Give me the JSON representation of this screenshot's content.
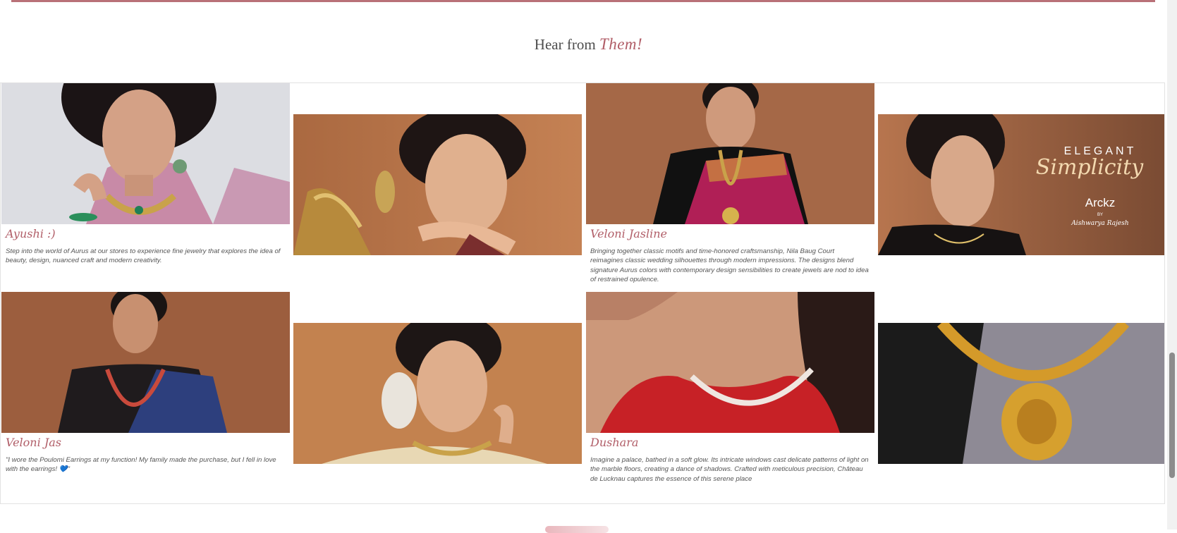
{
  "section": {
    "heading_prefix": "Hear from",
    "heading_accent": "Them!"
  },
  "testimonials": [
    {
      "name": "Ayushi :)",
      "text": "Step into the world of Aurus at our stores to experience fine jewelry that explores the idea of beauty, design, nuanced craft and modern creativity.",
      "photo": "woman in pink saree with green stone necklace and earrings"
    },
    {
      "name": "",
      "text": "",
      "photo": "woman with hand under chin wearing jhumka earrings, brass lotus"
    },
    {
      "name": "Veloni Jasline",
      "text": "Bringing together classic motifs and time-honored craftsmanship, Nila Baug Court reimagines classic wedding silhouettes through modern impressions. The designs blend signature Aurus colors with contemporary design sensibilities to create jewels are nod to idea of restrained opulence.",
      "photo": "woman in magenta saree with layered gold necklace"
    },
    {
      "name": "",
      "text": "",
      "photo": "ELEGANT Simplicity banner",
      "banner_line1": "ELEGANT",
      "banner_line2": "Simplicity",
      "banner_logo": "Arckz",
      "banner_by": "BY",
      "banner_sig": "Aishwarya Rajesh"
    },
    {
      "name": "Veloni Jas",
      "text": "\"I wore the Poulomi Earrings at my function! My family made the purchase, but I fell in love with the earrings! 💙\"",
      "photo": "woman in blue saree with long gold necklace"
    },
    {
      "name": "",
      "text": "",
      "photo": "woman with floral hair and gold choker"
    },
    {
      "name": "Dushara",
      "text": "Imagine a palace, bathed in a soft glow. Its intricate windows cast delicate patterns of light on the marble floors, creating a dance of shadows. Crafted with meticulous precision, Château de Lucknau captures the essence of this serene place",
      "photo": "close-up of diamond necklace on red blouse"
    },
    {
      "name": "",
      "text": "",
      "photo": "gold temple necklace on grey saree"
    }
  ],
  "colors": {
    "accent": "#b15e68",
    "rule": "#b97178"
  }
}
